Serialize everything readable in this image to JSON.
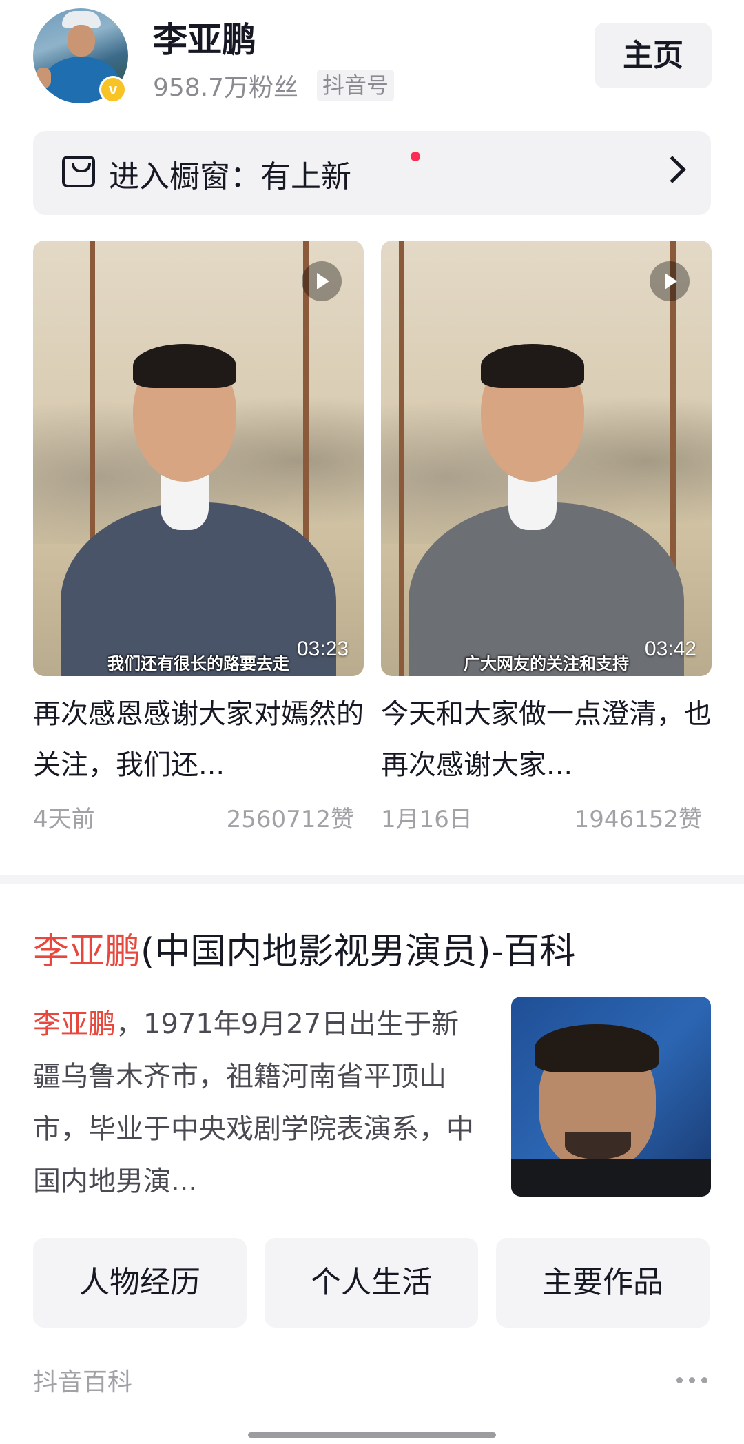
{
  "profile": {
    "name": "李亚鹏",
    "fans": "958.7万粉丝",
    "id_tag": "抖音号",
    "home_button": "主页",
    "verified_badge": "v"
  },
  "shop": {
    "label": "进入橱窗：有上新",
    "icon": "shopping-bag-icon",
    "has_new_dot": true
  },
  "videos": [
    {
      "duration": "03:23",
      "subtitle": "我们还有很长的路要去走",
      "title": "再次感恩感谢大家对嫣然的关注，我们还...",
      "date": "4天前",
      "likes": "2560712赞"
    },
    {
      "duration": "03:42",
      "subtitle": "广大网友的关注和支持",
      "title": "今天和大家做一点澄清，也再次感谢大家...",
      "date": "1月16日",
      "likes": "1946152赞"
    }
  ],
  "baike": {
    "title_name": "李亚鹏",
    "title_rest": "(中国内地影视男演员)-百科",
    "desc_name": "李亚鹏",
    "desc_rest": "，1971年9月27日出生于新疆乌鲁木齐市，祖籍河南省平顶山市，毕业于中央戏剧学院表演系，中国内地男演...",
    "tags": [
      "人物经历",
      "个人生活",
      "主要作品"
    ],
    "source": "抖音百科"
  },
  "colors": {
    "accent_red": "#e7473c",
    "notify_dot": "#fe2c55",
    "verified_yellow": "#f7c325"
  }
}
